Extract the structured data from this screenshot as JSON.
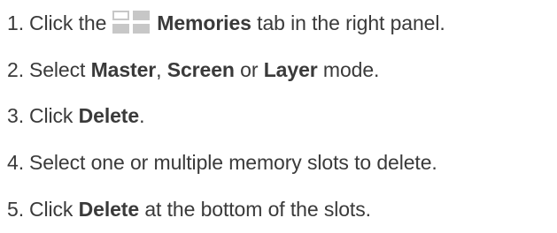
{
  "steps": [
    {
      "number": "1.",
      "text_before": "Click the",
      "icon": "memories-grid-icon",
      "bold": "Memories",
      "text_after": "tab in the right panel."
    },
    {
      "number": "2.",
      "text_before": "Select",
      "bold1": "Master",
      "sep1": ",",
      "bold2": "Screen",
      "sep2": "or",
      "bold3": "Layer",
      "text_after": "mode."
    },
    {
      "number": "3.",
      "text_before": "Click",
      "bold": "Delete",
      "text_after": "."
    },
    {
      "number": "4.",
      "text": "Select one or multiple memory slots to delete."
    },
    {
      "number": "5.",
      "text_before": "Click",
      "bold": "Delete",
      "text_after": "at the bottom of the slots."
    }
  ],
  "colors": {
    "text": "#3a3a3a",
    "icon_gray": "#c7c7c7"
  }
}
